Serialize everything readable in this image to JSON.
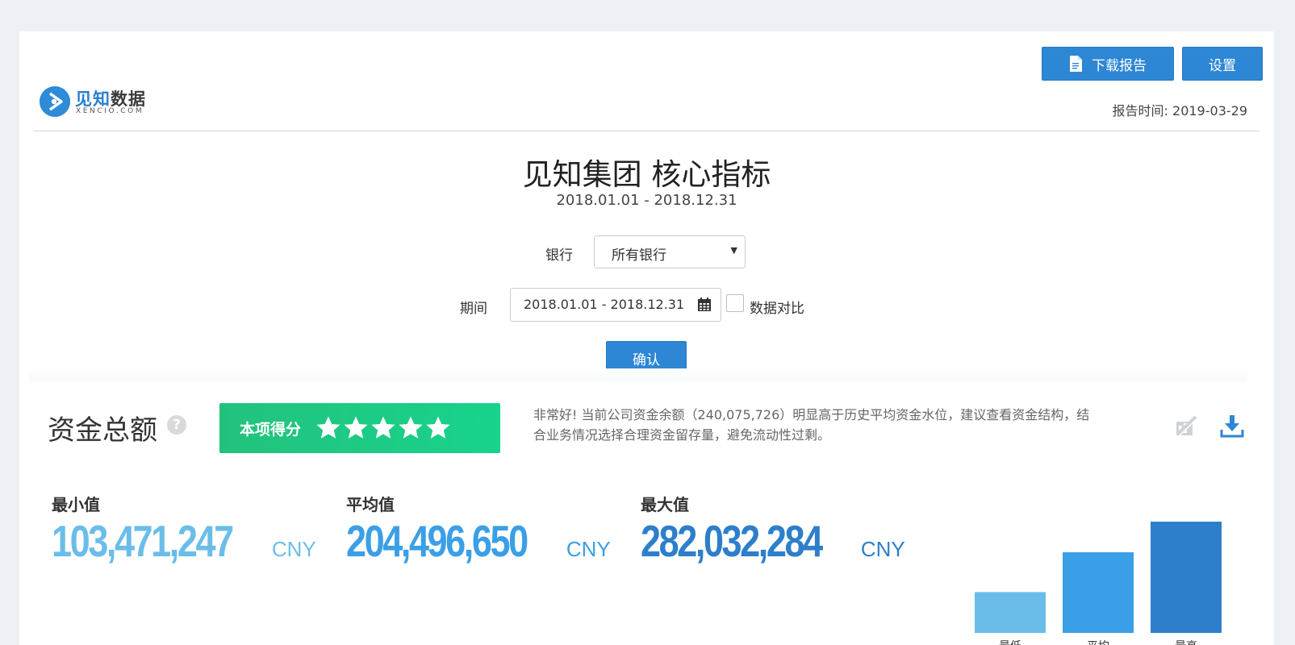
{
  "brand": {
    "name_part1": "见知",
    "name_part2": "数据",
    "tagline": "XENCIO.COM",
    "accent_color": "#2d87d4"
  },
  "header": {
    "download_label": "下载报告",
    "settings_label": "设置",
    "report_time_label": "报告时间: ",
    "report_time_value": "2019-03-29"
  },
  "page": {
    "title": "见知集团 核心指标",
    "subtitle": "2018.01.01 - 2018.12.31"
  },
  "filters": {
    "bank_label": "银行",
    "bank_selected": "所有银行",
    "period_label": "期间",
    "period_value": "2018.01.01 - 2018.12.31",
    "compare_label": "数据对比",
    "compare_checked": false,
    "confirm_label": "确认"
  },
  "section": {
    "title": "资金总额",
    "help_glyph": "?",
    "score_label": "本项得分",
    "rating": 5,
    "rating_max": 5,
    "description": "非常好! 当前公司资金余额（240,075,726）明显高于历史平均资金水位，建议查看资金结构，结合业务情况选择合理资金留存量，避免流动性过剩。",
    "icons": [
      "chart-hide-icon",
      "download-icon"
    ]
  },
  "stats": [
    {
      "label": "最小值",
      "value": "103,471,247",
      "unit": "CNY",
      "color": "#6bbde9"
    },
    {
      "label": "平均值",
      "value": "204,496,650",
      "unit": "CNY",
      "color": "#3a9fe6"
    },
    {
      "label": "最大值",
      "value": "282,032,284",
      "unit": "CNY",
      "color": "#2d7fcb"
    }
  ],
  "chart_data": {
    "type": "bar",
    "categories": [
      "最低",
      "平均",
      "最高"
    ],
    "values": [
      103471247,
      204496650,
      282032284
    ],
    "colors": [
      "#6bbde9",
      "#3a9fe6",
      "#2d7fcb"
    ],
    "title": "",
    "xlabel": "",
    "ylabel": "",
    "ylim": [
      0,
      282032284
    ],
    "grid": false
  }
}
